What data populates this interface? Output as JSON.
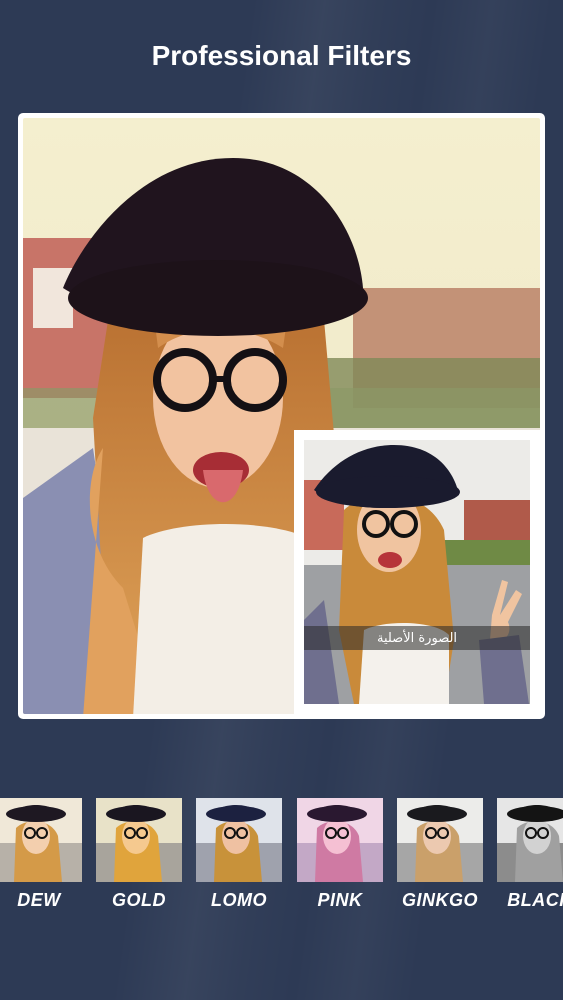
{
  "header": {
    "title": "Professional Filters"
  },
  "preview": {
    "main_photo": "filtered-photo",
    "original_label": "الصورة الأصلية"
  },
  "filters": [
    {
      "label": "DEW",
      "tint": "#e9d7b9"
    },
    {
      "label": "GOLD",
      "tint": "#d8b46a"
    },
    {
      "label": "LOMO",
      "tint": "#b9a9c8"
    },
    {
      "label": "PINK",
      "tint": "#e7a7c0"
    },
    {
      "label": "GINKGO",
      "tint": "#d7cfbf"
    },
    {
      "label": "BLACK",
      "tint": "#9a9a9a"
    }
  ]
}
